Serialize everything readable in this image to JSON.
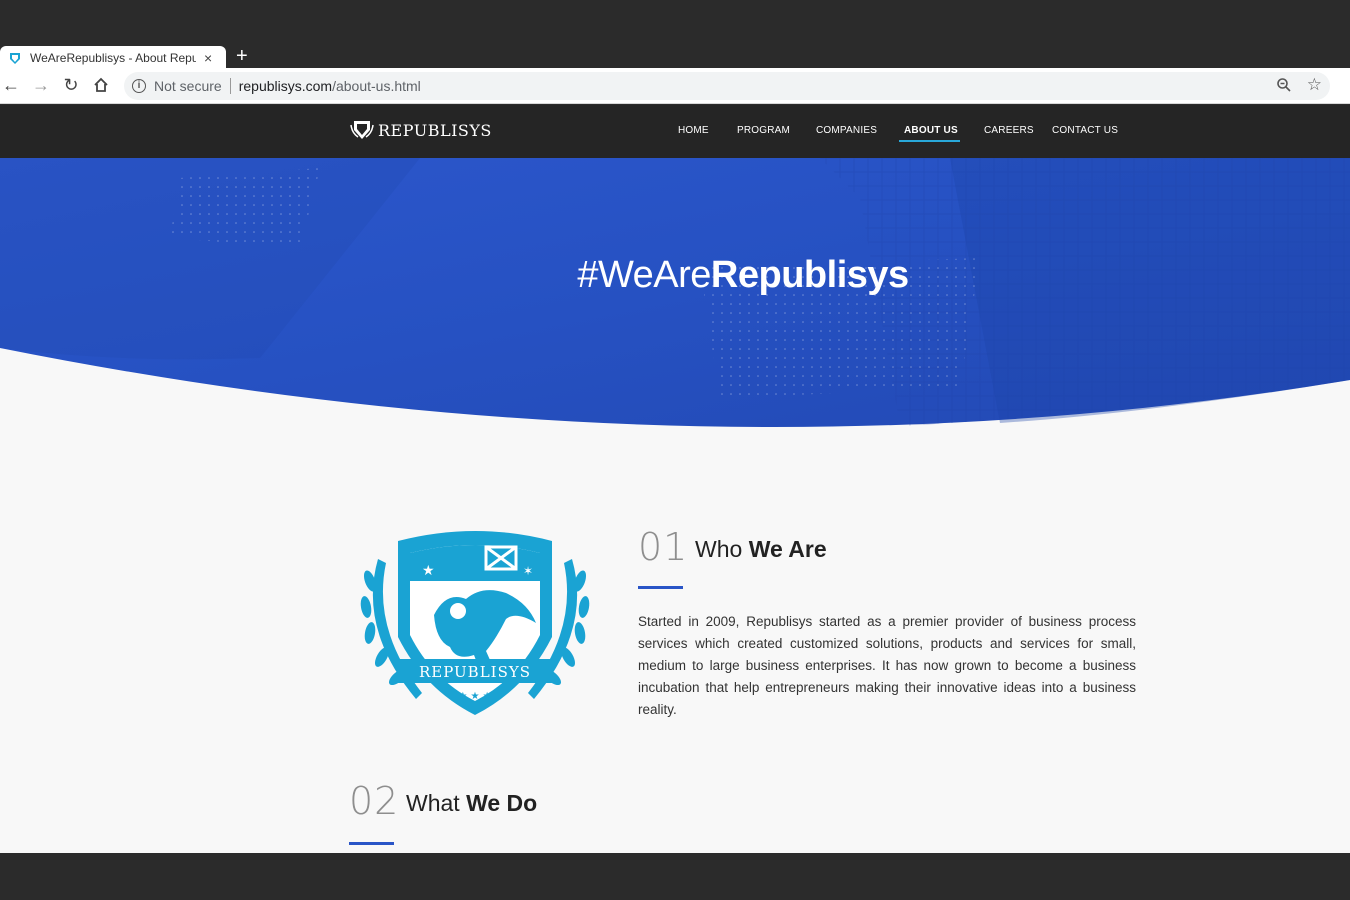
{
  "browser": {
    "tab_title": "WeAreRepublisys - About Repu",
    "tab_close": "×",
    "new_tab": "+",
    "security_label": "Not secure",
    "url_host": "republisys.com",
    "url_path": "/about-us.html"
  },
  "site": {
    "logo_text": "REPUBLISYS",
    "menu": [
      {
        "label": "HOME"
      },
      {
        "label": "PROGRAM"
      },
      {
        "label": "COMPANIES"
      },
      {
        "label": "ABOUT US",
        "active": true
      },
      {
        "label": "CAREERS"
      },
      {
        "label": "CONTACT US"
      }
    ],
    "hero": {
      "title_light": "#WeAre",
      "title_bold": "Republisys"
    },
    "crest_text": "REPUBLISYS",
    "sections": [
      {
        "number": "01",
        "title_light": "Who ",
        "title_bold": "We Are",
        "body": "Started in 2009, Republisys started as a premier provider of business process services which created customized solutions, products and services for small, medium to large business enterprises. It has now grown to become a business incubation that help entrepreneurs making their innovative ideas into a business reality."
      },
      {
        "number": "02",
        "title_light": "What ",
        "title_bold": "We Do"
      }
    ]
  },
  "colors": {
    "nav_bg": "#252525",
    "hero_blue": "#2a55c7",
    "active_underline": "#29a8d9",
    "crest": "#1aa3d3",
    "accent_rule": "#2a55c7"
  }
}
